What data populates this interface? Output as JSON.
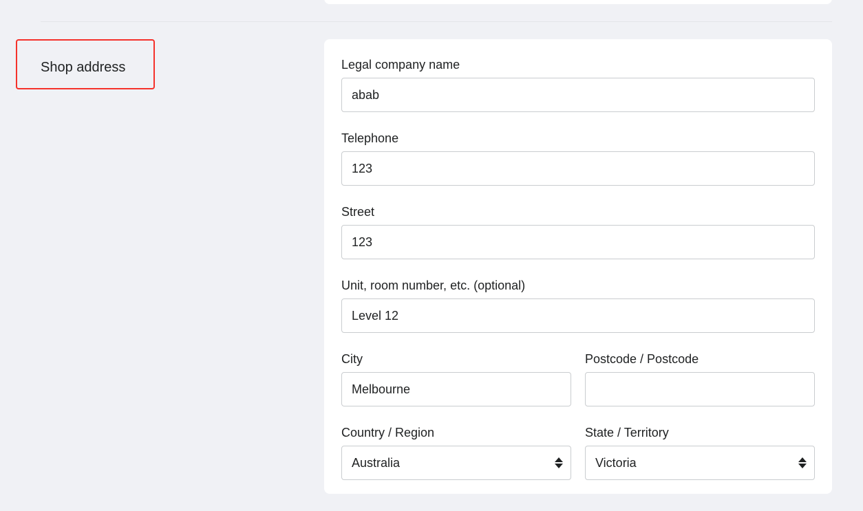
{
  "section": {
    "title": "Shop address"
  },
  "form": {
    "company_name": {
      "label": "Legal company name",
      "value": "abab"
    },
    "telephone": {
      "label": "Telephone",
      "value": "123"
    },
    "street": {
      "label": "Street",
      "value": "123"
    },
    "unit": {
      "label": "Unit, room number, etc. (optional)",
      "value": "Level 12"
    },
    "city": {
      "label": "City",
      "value": "Melbourne"
    },
    "postcode": {
      "label": "Postcode / Postcode",
      "value": ""
    },
    "country": {
      "label": "Country / Region",
      "selected": "Australia",
      "icon": "select-arrows-icon"
    },
    "state": {
      "label": "State / Territory",
      "selected": "Victoria",
      "icon": "select-arrows-icon"
    }
  },
  "colors": {
    "background": "#f0f1f5",
    "card": "#ffffff",
    "highlight": "#f5312a",
    "border": "#c9cccf",
    "text": "#202223"
  }
}
